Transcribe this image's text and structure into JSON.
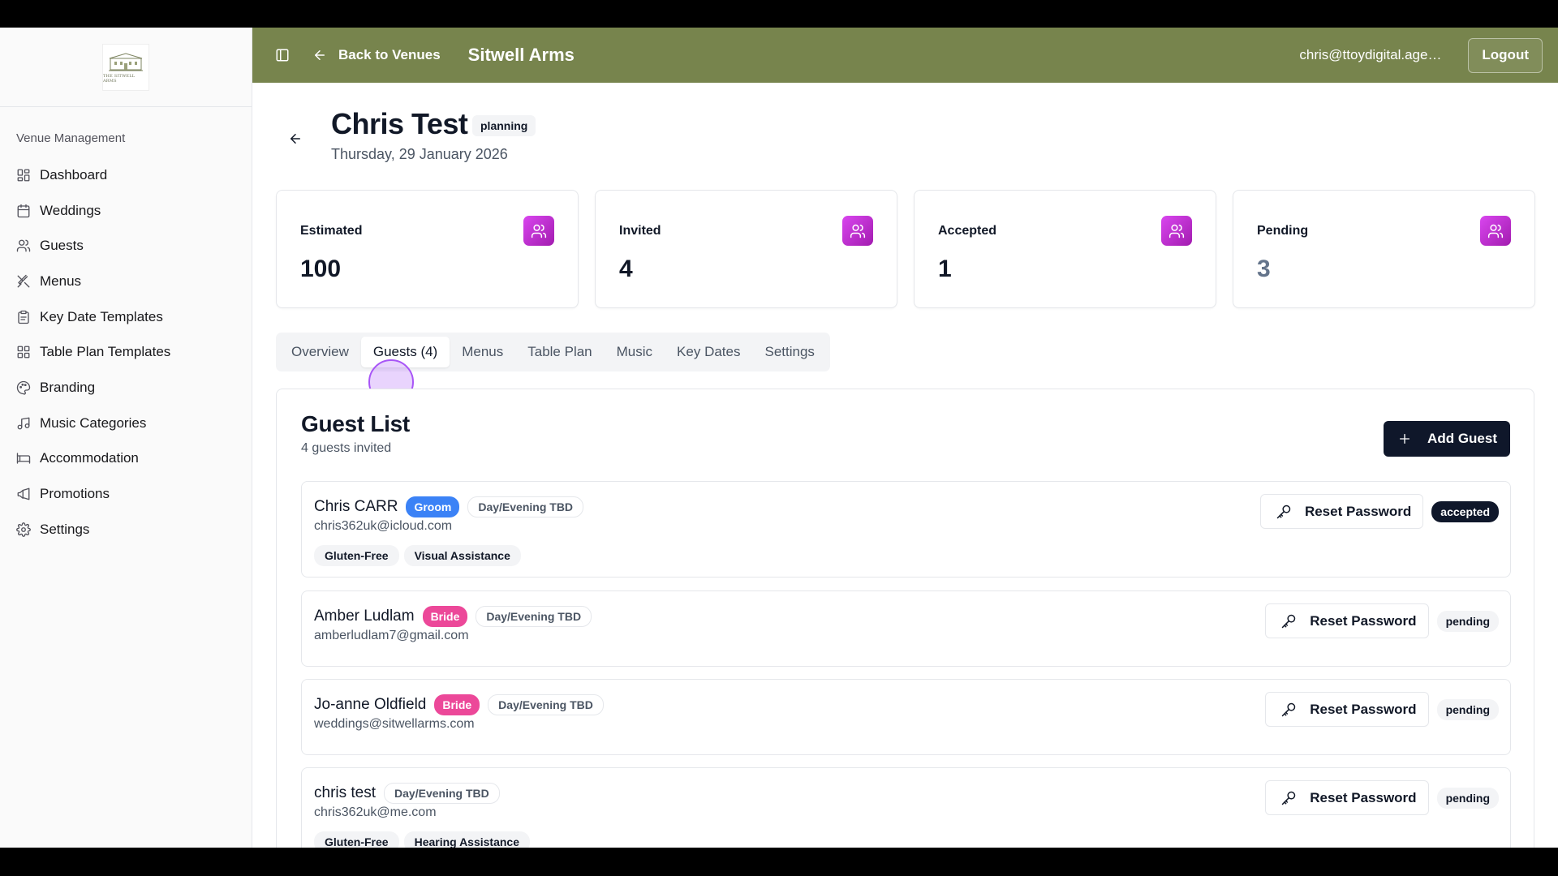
{
  "logo": {
    "text": "THE SITWELL ARMS"
  },
  "sidebar": {
    "group_label": "Venue Management",
    "items": [
      {
        "label": "Dashboard",
        "icon": "layout-grid-icon"
      },
      {
        "label": "Weddings",
        "icon": "calendar-icon"
      },
      {
        "label": "Guests",
        "icon": "users-icon"
      },
      {
        "label": "Menus",
        "icon": "utensils-icon"
      },
      {
        "label": "Key Date Templates",
        "icon": "clipboard-icon"
      },
      {
        "label": "Table Plan Templates",
        "icon": "layout-grid-icon"
      },
      {
        "label": "Branding",
        "icon": "palette-icon"
      },
      {
        "label": "Music Categories",
        "icon": "music-icon"
      },
      {
        "label": "Accommodation",
        "icon": "bed-icon"
      },
      {
        "label": "Promotions",
        "icon": "megaphone-icon"
      },
      {
        "label": "Settings",
        "icon": "gear-icon"
      }
    ]
  },
  "topbar": {
    "back_label": "Back to Venues",
    "venue_name": "Sitwell Arms",
    "user_email": "chris@ttoydigital.agency",
    "logout_label": "Logout",
    "color": "#77844d"
  },
  "wedding": {
    "title": "Chris Test",
    "status": "planning",
    "date": "Thursday, 29 January 2026"
  },
  "stats": [
    {
      "label": "Estimated",
      "value": "100"
    },
    {
      "label": "Invited",
      "value": "4"
    },
    {
      "label": "Accepted",
      "value": "1"
    },
    {
      "label": "Pending",
      "value": "3"
    }
  ],
  "tabs": [
    {
      "label": "Overview"
    },
    {
      "label": "Guests (4)",
      "active": true
    },
    {
      "label": "Menus"
    },
    {
      "label": "Table Plan"
    },
    {
      "label": "Music"
    },
    {
      "label": "Key Dates"
    },
    {
      "label": "Settings"
    }
  ],
  "guest_list": {
    "title": "Guest List",
    "subtitle": "4 guests invited",
    "add_label": "Add Guest",
    "reset_label": "Reset Password",
    "guests": [
      {
        "name": "Chris CARR",
        "role": "Groom",
        "attendance": "Day/Evening TBD",
        "email": "chris362uk@icloud.com",
        "tags": [
          "Gluten-Free",
          "Visual Assistance"
        ],
        "status": "accepted"
      },
      {
        "name": "Amber Ludlam",
        "role": "Bride",
        "attendance": "Day/Evening TBD",
        "email": "amberludlam7@gmail.com",
        "tags": [],
        "status": "pending"
      },
      {
        "name": "Jo-anne Oldfield",
        "role": "Bride",
        "attendance": "Day/Evening TBD",
        "email": "weddings@sitwellarms.com",
        "tags": [],
        "status": "pending"
      },
      {
        "name": "chris test",
        "role": "",
        "attendance": "Day/Evening TBD",
        "email": "chris362uk@me.com",
        "tags": [
          "Gluten-Free",
          "Hearing Assistance"
        ],
        "status": "pending"
      }
    ]
  },
  "colors": {
    "groom": "#3b82f6",
    "bride": "#ec4899",
    "accent": "#c026d3",
    "dark": "#0f172a"
  }
}
